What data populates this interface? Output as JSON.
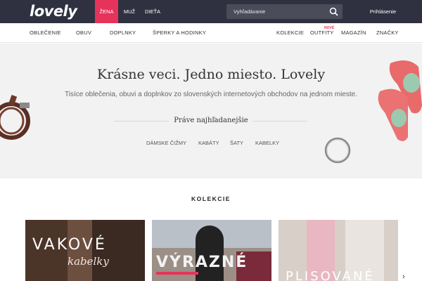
{
  "header": {
    "logo": "lovely",
    "genders": [
      {
        "label": "ŽENA",
        "active": true
      },
      {
        "label": "MUŽ",
        "active": false
      },
      {
        "label": "DIEŤA",
        "active": false
      }
    ],
    "search_placeholder": "Vyhľadávanie",
    "login": "Prihlásenie"
  },
  "catnav": {
    "left": [
      "OBLEČENIE",
      "OBUV",
      "DOPLNKY",
      "ŠPERKY A HODINKY"
    ],
    "right": [
      "KOLEKCIE",
      "OUTFITY",
      "MAGAZÍN",
      "ZNAČKY"
    ],
    "new_badge": "NOVÉ"
  },
  "hero": {
    "title": "Krásne veci. Jedno miesto. Lovely",
    "subtitle": "Tisíce oblečenia, obuvi a doplnkov zo slovenských internetových obchodov na jednom mieste.",
    "popular_heading": "Práve najhľadanejšie",
    "popular": [
      "DÁMSKE ČIŽMY",
      "KABÁTY",
      "ŠATY",
      "KABELKY"
    ]
  },
  "collections": {
    "heading": "KOLEKCIE",
    "cards": [
      {
        "title": "VAKOVÉ",
        "script": "kabelky"
      },
      {
        "title": "VÝRAZNÉ",
        "script": ""
      },
      {
        "title": "PLISOVANÉ",
        "script": ""
      }
    ],
    "next_icon": "chevron-right-icon"
  },
  "colors": {
    "topbar": "#2f3140",
    "accent": "#e6335c",
    "hero_bg": "#f2f2f2"
  }
}
